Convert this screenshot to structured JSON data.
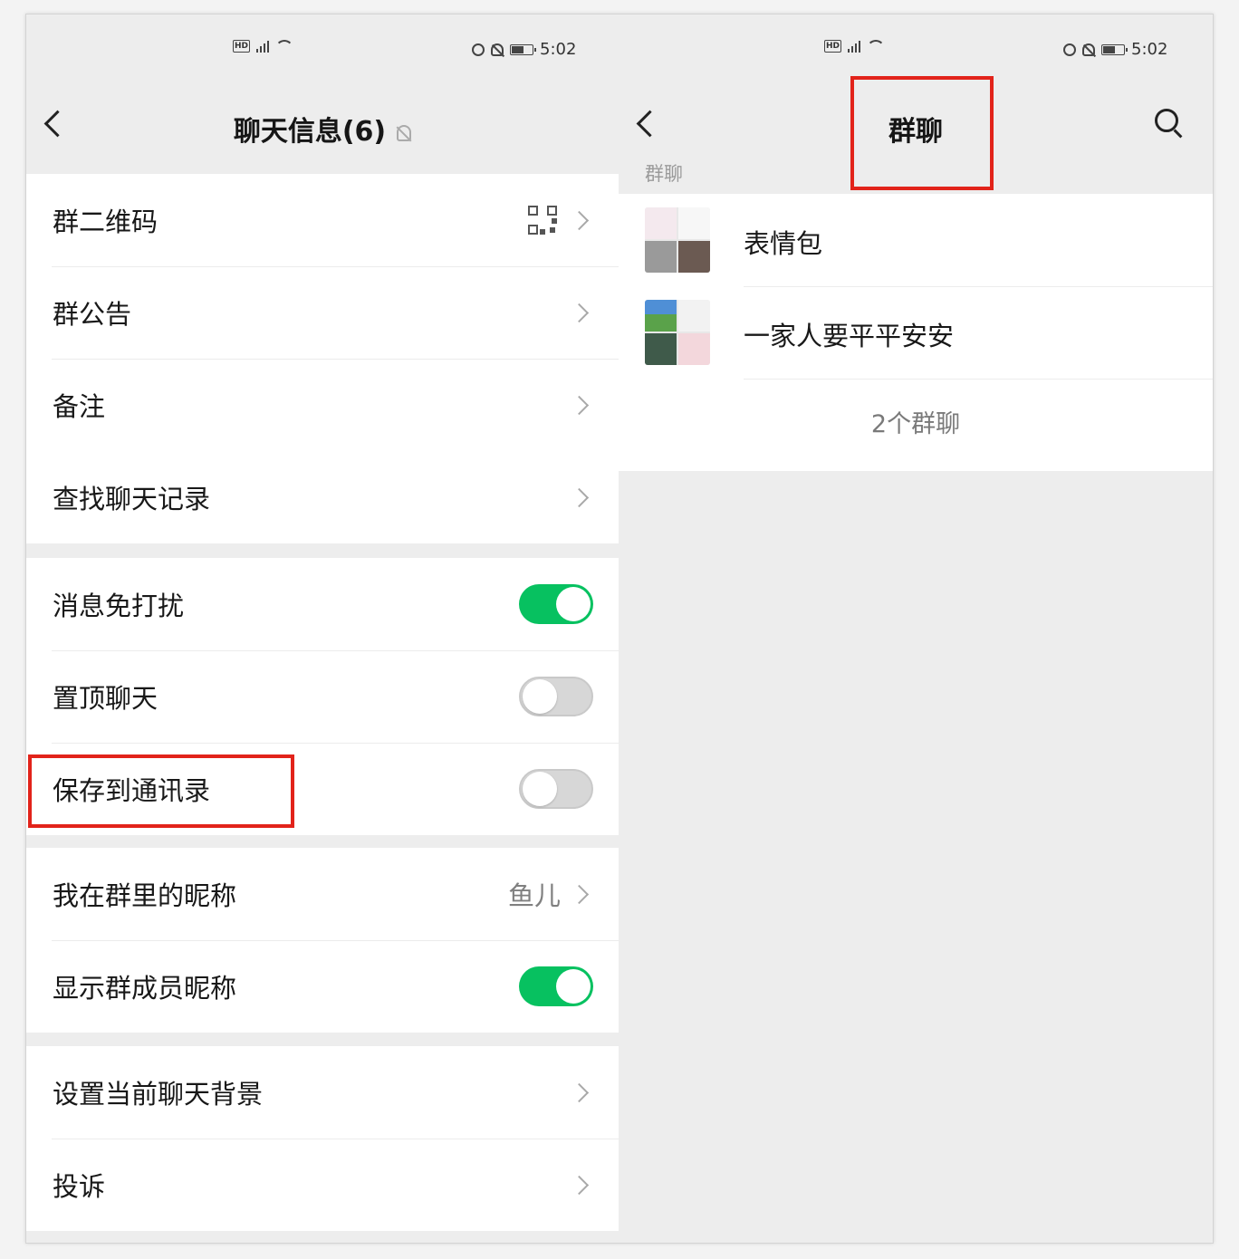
{
  "status_bar": {
    "net_label": "HD",
    "time": "5:02"
  },
  "chat_info": {
    "title": "聊天信息(6)",
    "group1": [
      {
        "label": "群二维码",
        "icon": "qr-code-icon"
      },
      {
        "label": "群公告"
      },
      {
        "label": "备注"
      }
    ],
    "group2": [
      {
        "label": "查找聊天记录"
      }
    ],
    "group3": [
      {
        "label": "消息免打扰",
        "toggle": true
      },
      {
        "label": "置顶聊天",
        "toggle": false
      },
      {
        "label": "保存到通讯录",
        "toggle": false,
        "highlighted": true
      }
    ],
    "group4": [
      {
        "label": "我在群里的昵称",
        "value": "鱼儿"
      },
      {
        "label": "显示群成员昵称",
        "toggle": true
      }
    ],
    "group5": [
      {
        "label": "设置当前聊天背景"
      },
      {
        "label": "投诉"
      }
    ]
  },
  "group_list": {
    "title": "群聊",
    "section_label": "群聊",
    "items": [
      {
        "name": "表情包"
      },
      {
        "name": "一家人要平平安安"
      }
    ],
    "footer": "2个群聊"
  },
  "colors": {
    "toggle_on": "#07c160",
    "highlight": "#e2231a",
    "background": "#ededed"
  }
}
